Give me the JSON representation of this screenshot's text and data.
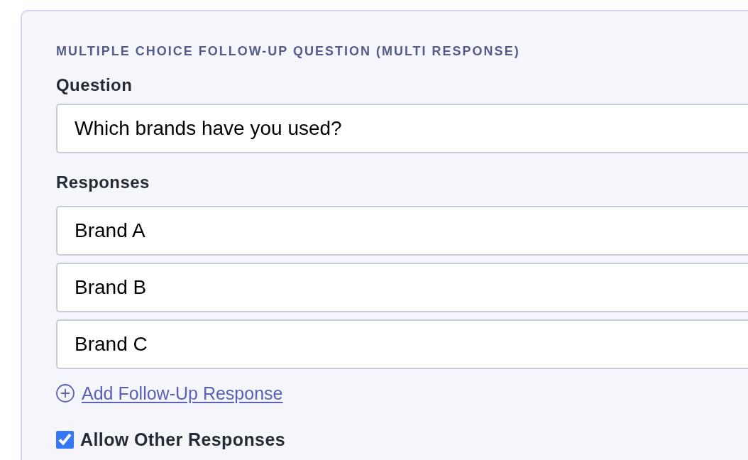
{
  "section": {
    "heading": "MULTIPLE CHOICE FOLLOW-UP QUESTION (MULTI RESPONSE)",
    "question": {
      "label": "Question",
      "value": "Which brands have you used?"
    },
    "responses": {
      "label": "Responses",
      "items": [
        {
          "value": "Brand A"
        },
        {
          "value": "Brand B"
        },
        {
          "value": "Brand C"
        }
      ]
    },
    "add_link": "Add Follow-Up Response",
    "allow_other": {
      "label": "Allow Other Responses",
      "checked": true
    }
  }
}
